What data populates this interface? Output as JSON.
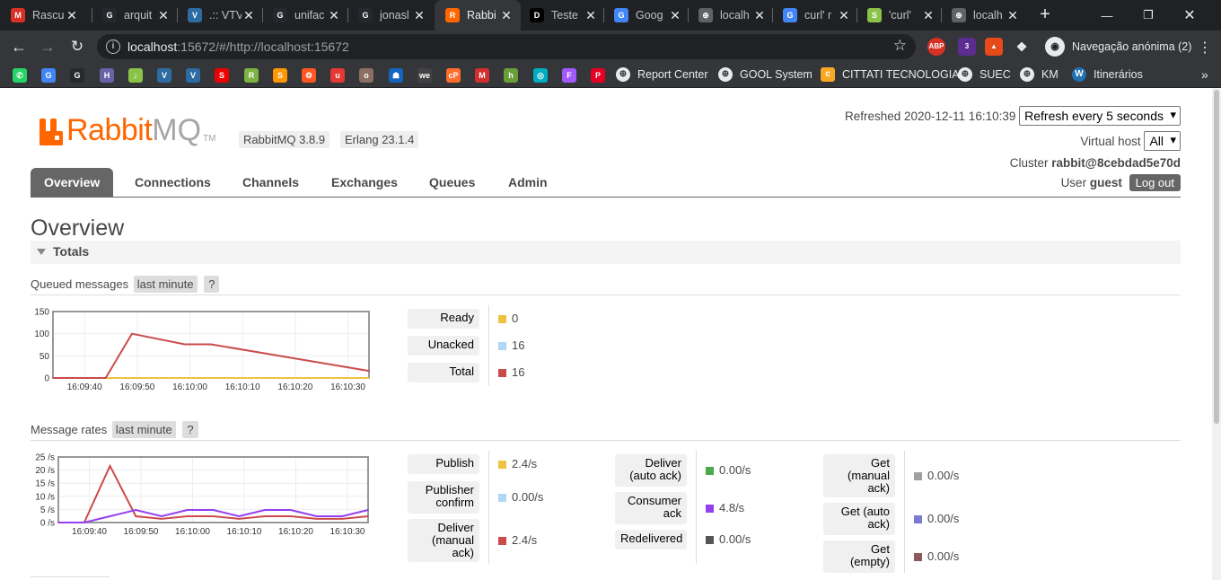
{
  "browser": {
    "tabs": [
      {
        "label": "Rascu",
        "icon": "gmail-icon",
        "color": "#d93025",
        "glyph": "M"
      },
      {
        "label": "arquit",
        "icon": "github-icon",
        "color": "#24292e",
        "glyph": "G"
      },
      {
        "label": ".:: VTV",
        "icon": "vtv-icon",
        "color": "#2d6ca2",
        "glyph": "V"
      },
      {
        "label": "unifac",
        "icon": "github-icon",
        "color": "#24292e",
        "glyph": "G"
      },
      {
        "label": "jonasl",
        "icon": "github-icon",
        "color": "#24292e",
        "glyph": "G"
      },
      {
        "label": "Rabbi",
        "icon": "rabbitmq-icon",
        "color": "#f60",
        "glyph": "R",
        "active": true
      },
      {
        "label": "Teste",
        "icon": "dev-icon",
        "color": "#000",
        "glyph": "DEV"
      },
      {
        "label": "Goog",
        "icon": "google-translate-icon",
        "color": "#4285f4",
        "glyph": "G"
      },
      {
        "label": "localh",
        "icon": "globe-icon",
        "color": "#5f6368",
        "glyph": "⊕"
      },
      {
        "label": "curl' r",
        "icon": "google-icon",
        "color": "#4285f4",
        "glyph": "G"
      },
      {
        "label": "'curl'",
        "icon": "snake-icon",
        "color": "#8bc34a",
        "glyph": "S"
      },
      {
        "label": "localh",
        "icon": "globe-icon",
        "color": "#5f6368",
        "glyph": "⊕"
      }
    ],
    "url_host": "localhost",
    "url_rest": ":15672/#/http://localhost:15672",
    "incognito_label": "Navegação anónima (2)",
    "bookmarks_text": [
      "Report Center",
      "GOOL System",
      "CITTATI TECNOLOGIA",
      "SUEC",
      "KM",
      "Itinerários"
    ],
    "extension_badge": "3"
  },
  "header": {
    "logo_rabbit": "Rabbit",
    "logo_mq": "MQ",
    "logo_tm": "TM",
    "rabbitmq_version": "RabbitMQ 3.8.9",
    "erlang_version": "Erlang 23.1.4",
    "refreshed_label": "Refreshed 2020-12-11 16:10:39",
    "refresh_select": "Refresh every 5 seconds",
    "virtual_host_label": "Virtual host",
    "virtual_host_value": "All",
    "cluster_label": "Cluster",
    "cluster_value": "rabbit@8cebdad5e70d",
    "user_label": "User",
    "user_value": "guest",
    "logout_label": "Log out"
  },
  "nav": {
    "tabs": [
      "Overview",
      "Connections",
      "Channels",
      "Exchanges",
      "Queues",
      "Admin"
    ],
    "active": "Overview"
  },
  "main": {
    "title": "Overview",
    "totals_label": "Totals",
    "queued": {
      "label": "Queued messages",
      "period": "last minute",
      "help": "?",
      "legend": [
        {
          "label": "Ready",
          "value": "0",
          "color": "#edc240"
        },
        {
          "label": "Unacked",
          "value": "16",
          "color": "#afd8f8"
        },
        {
          "label": "Total",
          "value": "16",
          "color": "#cb4b4b"
        }
      ]
    },
    "rates": {
      "label": "Message rates",
      "period": "last minute",
      "help": "?",
      "legend_col1": [
        {
          "label": "Publish",
          "value": "2.4/s",
          "color": "#edc240"
        },
        {
          "label": "Publisher\nconfirm",
          "value": "0.00/s",
          "color": "#afd8f8"
        },
        {
          "label": "Deliver\n(manual\nack)",
          "value": "2.4/s",
          "color": "#cb4b4b"
        }
      ],
      "legend_col2": [
        {
          "label": "Deliver\n(auto ack)",
          "value": "0.00/s",
          "color": "#4da74d"
        },
        {
          "label": "Consumer\nack",
          "value": "4.8/s",
          "color": "#9440ed"
        },
        {
          "label": "Redelivered",
          "value": "0.00/s",
          "color": "#555555"
        }
      ],
      "legend_col3": [
        {
          "label": "Get\n(manual\nack)",
          "value": "0.00/s",
          "color": "#a0a0a0"
        },
        {
          "label": "Get (auto\nack)",
          "value": "0.00/s",
          "color": "#7a7ad0"
        },
        {
          "label": "Get\n(empty)",
          "value": "0.00/s",
          "color": "#8d5a5a"
        }
      ]
    }
  },
  "chart_data": [
    {
      "type": "line",
      "title": "Queued messages",
      "x": [
        "16:09:40",
        "16:09:45",
        "16:09:50",
        "16:09:55",
        "16:10:00",
        "16:10:05",
        "16:10:10",
        "16:10:15",
        "16:10:20",
        "16:10:25",
        "16:10:30"
      ],
      "xticks": [
        "16:09:40",
        "16:09:50",
        "16:10:00",
        "16:10:10",
        "16:10:20",
        "16:10:30"
      ],
      "ylim": [
        0,
        150
      ],
      "yticks": [
        "0",
        "50",
        "100",
        "150"
      ],
      "x_start": "16:09:34",
      "x_end": "16:10:34",
      "series": [
        {
          "name": "Ready",
          "color": "#edc240",
          "points": [
            [
              "16:09:34",
              0
            ],
            [
              "16:10:34",
              0
            ]
          ]
        },
        {
          "name": "Total",
          "color": "#cb4b4b",
          "points": [
            [
              "16:09:34",
              0
            ],
            [
              "16:09:44",
              0
            ],
            [
              "16:09:49",
              100
            ],
            [
              "16:09:59",
              76
            ],
            [
              "16:10:04",
              76
            ],
            [
              "16:10:34",
              16
            ]
          ]
        }
      ]
    },
    {
      "type": "line",
      "title": "Message rates",
      "xticks": [
        "16:09:40",
        "16:09:50",
        "16:10:00",
        "16:10:10",
        "16:10:20",
        "16:10:30"
      ],
      "ylim": [
        0,
        25
      ],
      "yticks": [
        "0 /s",
        "5 /s",
        "10 /s",
        "15 /s",
        "20 /s",
        "25 /s"
      ],
      "x_start": "16:09:34",
      "x_end": "16:10:34",
      "series": [
        {
          "name": "Deliver (manual ack)",
          "color": "#cb4b4b",
          "points": [
            [
              "16:09:34",
              0
            ],
            [
              "16:09:39",
              0
            ],
            [
              "16:09:44",
              21.6
            ],
            [
              "16:09:49",
              2.4
            ],
            [
              "16:09:54",
              1.4
            ],
            [
              "16:09:59",
              2.4
            ],
            [
              "16:10:04",
              2.4
            ],
            [
              "16:10:09",
              1.4
            ],
            [
              "16:10:14",
              2.4
            ],
            [
              "16:10:19",
              2.4
            ],
            [
              "16:10:24",
              1.4
            ],
            [
              "16:10:29",
              1.4
            ],
            [
              "16:10:34",
              2.4
            ]
          ]
        },
        {
          "name": "Consumer ack",
          "color": "#9440ed",
          "points": [
            [
              "16:09:34",
              0
            ],
            [
              "16:09:39",
              0
            ],
            [
              "16:09:44",
              2.4
            ],
            [
              "16:09:49",
              4.8
            ],
            [
              "16:09:54",
              2.4
            ],
            [
              "16:09:59",
              4.8
            ],
            [
              "16:10:04",
              4.8
            ],
            [
              "16:10:09",
              2.4
            ],
            [
              "16:10:14",
              4.8
            ],
            [
              "16:10:19",
              4.8
            ],
            [
              "16:10:24",
              2.4
            ],
            [
              "16:10:29",
              2.4
            ],
            [
              "16:10:34",
              4.8
            ]
          ]
        }
      ]
    }
  ]
}
